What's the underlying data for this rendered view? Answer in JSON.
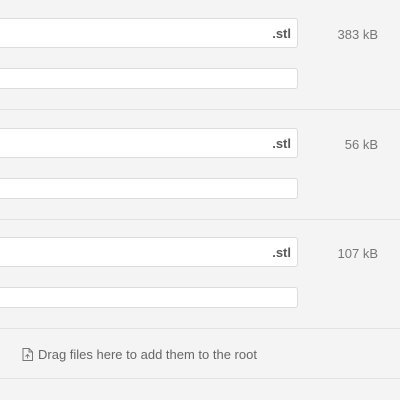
{
  "files": [
    {
      "extension": ".stl",
      "size": "383 kB"
    },
    {
      "extension": ".stl",
      "size": "56 kB"
    },
    {
      "extension": ".stl",
      "size": "107 kB"
    }
  ],
  "drop_zone": {
    "icon": "file-icon",
    "label": "Drag files here to add them to the root"
  }
}
